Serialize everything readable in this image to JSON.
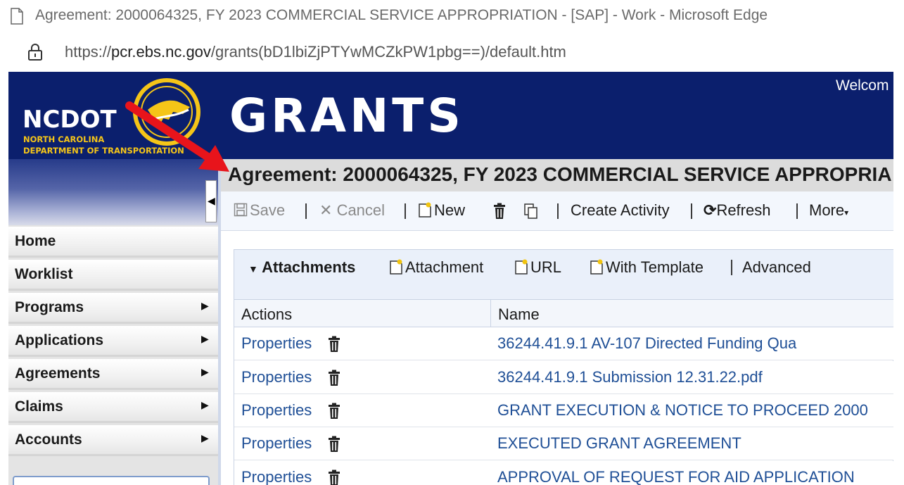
{
  "browser": {
    "window_title": "Agreement: 2000064325, FY 2023 COMMERCIAL SERVICE APPROPRIATION - [SAP] - Work - Microsoft Edge",
    "url_prefix": "https://",
    "url_domain": "pcr.ebs.nc.gov",
    "url_path": "/grants(bD1lbiZjPTYwMCZkPW1pbg==)/default.htm"
  },
  "header": {
    "logo_main": "NCDOT",
    "logo_line1": "NORTH CAROLINA",
    "logo_line2": "DEPARTMENT OF TRANSPORTATION",
    "app_title": "GRANTS",
    "welcome": "Welcom"
  },
  "sidebar": {
    "items": [
      {
        "label": "Home",
        "has_submenu": false
      },
      {
        "label": "Worklist",
        "has_submenu": false
      },
      {
        "label": "Programs",
        "has_submenu": true
      },
      {
        "label": "Applications",
        "has_submenu": true
      },
      {
        "label": "Agreements",
        "has_submenu": true
      },
      {
        "label": "Claims",
        "has_submenu": true
      },
      {
        "label": "Accounts",
        "has_submenu": true
      }
    ]
  },
  "main": {
    "page_title": "Agreement: 2000064325, FY 2023 COMMERCIAL SERVICE APPROPRIA",
    "toolbar": {
      "save": "Save",
      "cancel": "Cancel",
      "new": "New",
      "create_activity": "Create Activity",
      "refresh": "Refresh",
      "more": "More"
    },
    "attachments": {
      "title": "Attachments",
      "add_attachment": "Attachment",
      "add_url": "URL",
      "add_with_template": "With Template",
      "advanced": "Advanced",
      "columns": [
        "Actions",
        "Name"
      ],
      "rows": [
        {
          "action": "Properties",
          "name": "36244.41.9.1 AV-107 Directed Funding Qua"
        },
        {
          "action": "Properties",
          "name": "36244.41.9.1 Submission 12.31.22.pdf"
        },
        {
          "action": "Properties",
          "name": "GRANT EXECUTION & NOTICE TO PROCEED 2000"
        },
        {
          "action": "Properties",
          "name": "EXECUTED GRANT AGREEMENT"
        },
        {
          "action": "Properties",
          "name": "APPROVAL OF REQUEST FOR AID APPLICATION"
        }
      ]
    }
  },
  "colors": {
    "header_bg": "#0b1f6d",
    "logo_gold": "#f5c518",
    "link_blue": "#1f4f96",
    "annotation_arrow": "#e8141b"
  }
}
